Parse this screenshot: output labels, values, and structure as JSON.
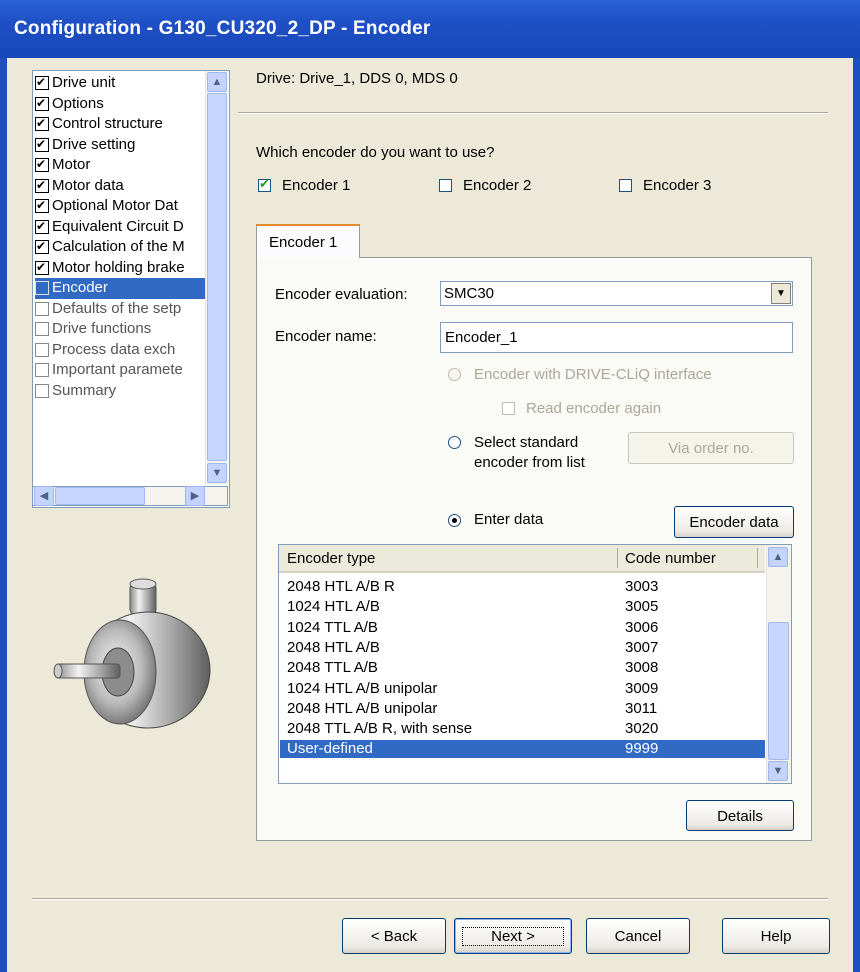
{
  "window": {
    "title": "Configuration - G130_CU320_2_DP - Encoder"
  },
  "tree": {
    "items": [
      {
        "label": "Drive unit",
        "checked": true
      },
      {
        "label": "Options",
        "checked": true
      },
      {
        "label": "Control structure",
        "checked": true
      },
      {
        "label": "Drive setting",
        "checked": true
      },
      {
        "label": "Motor",
        "checked": true
      },
      {
        "label": "Motor data",
        "checked": true
      },
      {
        "label": "Optional Motor Dat",
        "checked": true
      },
      {
        "label": "Equivalent Circuit D",
        "checked": true
      },
      {
        "label": "Calculation of the M",
        "checked": true
      },
      {
        "label": "Motor holding brake",
        "checked": true
      },
      {
        "label": "Encoder",
        "checked": false,
        "selected": true
      },
      {
        "label": "Defaults of the setp",
        "checked": false
      },
      {
        "label": "Drive functions",
        "checked": false
      },
      {
        "label": "Process data exch",
        "checked": false
      },
      {
        "label": "Important paramete",
        "checked": false
      },
      {
        "label": "Summary",
        "checked": false
      }
    ]
  },
  "header": {
    "drive_info": "Drive: Drive_1, DDS 0, MDS 0"
  },
  "question": "Which encoder do you want to use?",
  "encoders": {
    "e1": {
      "label": "Encoder 1",
      "checked": true
    },
    "e2": {
      "label": "Encoder 2",
      "checked": false
    },
    "e3": {
      "label": "Encoder 3",
      "checked": false
    }
  },
  "tab": {
    "label": "Encoder 1"
  },
  "form": {
    "evaluation_label": "Encoder evaluation:",
    "evaluation_value": "SMC30",
    "name_label": "Encoder name:",
    "name_value": "Encoder_1",
    "drivecliq_label": "Encoder with DRIVE-CLiQ interface",
    "read_again_label": "Read encoder again",
    "select_standard_line1": "Select standard",
    "select_standard_line2": "encoder from list",
    "via_order_label": "Via order no.",
    "enter_data_label": "Enter data",
    "encoder_data_button": "Encoder data",
    "details_button": "Details"
  },
  "table": {
    "columns": [
      "Encoder type",
      "Code number"
    ],
    "rows": [
      {
        "type": "2048 HTL A/B R",
        "code": "3003"
      },
      {
        "type": "1024 HTL A/B",
        "code": "3005"
      },
      {
        "type": "1024 TTL A/B",
        "code": "3006"
      },
      {
        "type": "2048 HTL A/B",
        "code": "3007"
      },
      {
        "type": "2048 TTL A/B",
        "code": "3008"
      },
      {
        "type": "1024 HTL A/B unipolar",
        "code": "3009"
      },
      {
        "type": "2048 HTL A/B unipolar",
        "code": "3011"
      },
      {
        "type": "2048 TTL A/B R, with sense",
        "code": "3020"
      },
      {
        "type": "User-defined",
        "code": "9999",
        "selected": true
      }
    ]
  },
  "footer": {
    "back": "< Back",
    "next": "Next >",
    "cancel": "Cancel",
    "help": "Help"
  },
  "colors": {
    "title_bar": "#1f50c4",
    "selection": "#316ac5",
    "dialog_bg": "#ece9d8"
  }
}
